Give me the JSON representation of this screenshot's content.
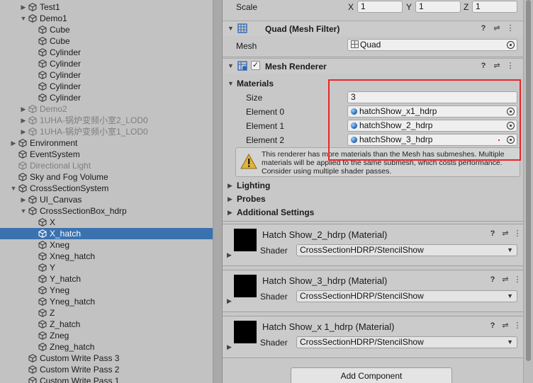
{
  "hierarchy": {
    "items": [
      {
        "label": "Test1",
        "indent": 3,
        "fold": "right",
        "dim": false
      },
      {
        "label": "Demo1",
        "indent": 3,
        "fold": "down",
        "dim": false
      },
      {
        "label": "Cube",
        "indent": 4,
        "fold": "",
        "dim": false
      },
      {
        "label": "Cube",
        "indent": 4,
        "fold": "",
        "dim": false
      },
      {
        "label": "Cylinder",
        "indent": 4,
        "fold": "",
        "dim": false
      },
      {
        "label": "Cylinder",
        "indent": 4,
        "fold": "",
        "dim": false
      },
      {
        "label": "Cylinder",
        "indent": 4,
        "fold": "",
        "dim": false
      },
      {
        "label": "Cylinder",
        "indent": 4,
        "fold": "",
        "dim": false
      },
      {
        "label": "Cylinder",
        "indent": 4,
        "fold": "",
        "dim": false
      },
      {
        "label": "Demo2",
        "indent": 3,
        "fold": "right",
        "dim": true
      },
      {
        "label": "1UHA-锅炉变频小室2_LOD0",
        "indent": 3,
        "fold": "right",
        "dim": true
      },
      {
        "label": "1UHA-锅炉变频小室1_LOD0",
        "indent": 3,
        "fold": "right",
        "dim": true
      },
      {
        "label": "Environment",
        "indent": 2,
        "fold": "right",
        "dim": false
      },
      {
        "label": "EventSystem",
        "indent": 2,
        "fold": "",
        "dim": false
      },
      {
        "label": "Directional Light",
        "indent": 2,
        "fold": "",
        "dim": true
      },
      {
        "label": "Sky and Fog Volume",
        "indent": 2,
        "fold": "",
        "dim": false
      },
      {
        "label": "CrossSectionSystem",
        "indent": 2,
        "fold": "down",
        "dim": false
      },
      {
        "label": "UI_Canvas",
        "indent": 3,
        "fold": "right",
        "dim": false
      },
      {
        "label": "CrossSectionBox_hdrp",
        "indent": 3,
        "fold": "down",
        "dim": false
      },
      {
        "label": "X",
        "indent": 4,
        "fold": "",
        "dim": false
      },
      {
        "label": "X_hatch",
        "indent": 4,
        "fold": "",
        "dim": false,
        "selected": true
      },
      {
        "label": "Xneg",
        "indent": 4,
        "fold": "",
        "dim": false
      },
      {
        "label": "Xneg_hatch",
        "indent": 4,
        "fold": "",
        "dim": false
      },
      {
        "label": "Y",
        "indent": 4,
        "fold": "",
        "dim": false
      },
      {
        "label": "Y_hatch",
        "indent": 4,
        "fold": "",
        "dim": false
      },
      {
        "label": "Yneg",
        "indent": 4,
        "fold": "",
        "dim": false
      },
      {
        "label": "Yneg_hatch",
        "indent": 4,
        "fold": "",
        "dim": false
      },
      {
        "label": "Z",
        "indent": 4,
        "fold": "",
        "dim": false
      },
      {
        "label": "Z_hatch",
        "indent": 4,
        "fold": "",
        "dim": false
      },
      {
        "label": "Zneg",
        "indent": 4,
        "fold": "",
        "dim": false
      },
      {
        "label": "Zneg_hatch",
        "indent": 4,
        "fold": "",
        "dim": false
      },
      {
        "label": "Custom Write Pass 3",
        "indent": 3,
        "fold": "",
        "dim": false
      },
      {
        "label": "Custom Write Pass 2",
        "indent": 3,
        "fold": "",
        "dim": false
      },
      {
        "label": "Custom Write Pass 1",
        "indent": 3,
        "fold": "",
        "dim": false
      }
    ]
  },
  "transform": {
    "scale_label": "Scale",
    "x_label": "X",
    "x_value": "1",
    "y_label": "Y",
    "y_value": "1",
    "z_label": "Z",
    "z_value": "1"
  },
  "mesh_filter": {
    "title": "Quad (Mesh Filter)",
    "mesh_label": "Mesh",
    "mesh_value": "Quad"
  },
  "mesh_renderer": {
    "title": "Mesh Renderer",
    "materials_label": "Materials",
    "size_label": "Size",
    "size_value": "3",
    "elements": [
      {
        "label": "Element 0",
        "value": "hatchShow_x1_hdrp"
      },
      {
        "label": "Element 1",
        "value": "hatchShow_2_hdrp"
      },
      {
        "label": "Element 2",
        "value": "hatchShow_3_hdrp"
      }
    ],
    "warning": "This renderer has more materials than the Mesh has submeshes. Multiple materials will be applied to the same submesh, which costs performance. Consider using multiple shader passes.",
    "sections": [
      "Lighting",
      "Probes",
      "Additional Settings"
    ]
  },
  "materials": [
    {
      "title": "Hatch Show_2_hdrp (Material)",
      "shader_label": "Shader",
      "shader_value": "CrossSectionHDRP/StencilShow"
    },
    {
      "title": "Hatch Show_3_hdrp (Material)",
      "shader_label": "Shader",
      "shader_value": "CrossSectionHDRP/StencilShow"
    },
    {
      "title": "Hatch Show_x 1_hdrp (Material)",
      "shader_label": "Shader",
      "shader_value": "CrossSectionHDRP/StencilShow"
    }
  ],
  "add_component_label": "Add Component",
  "colors": {
    "selection": "#3a72b0",
    "highlight": "#e8262a"
  }
}
